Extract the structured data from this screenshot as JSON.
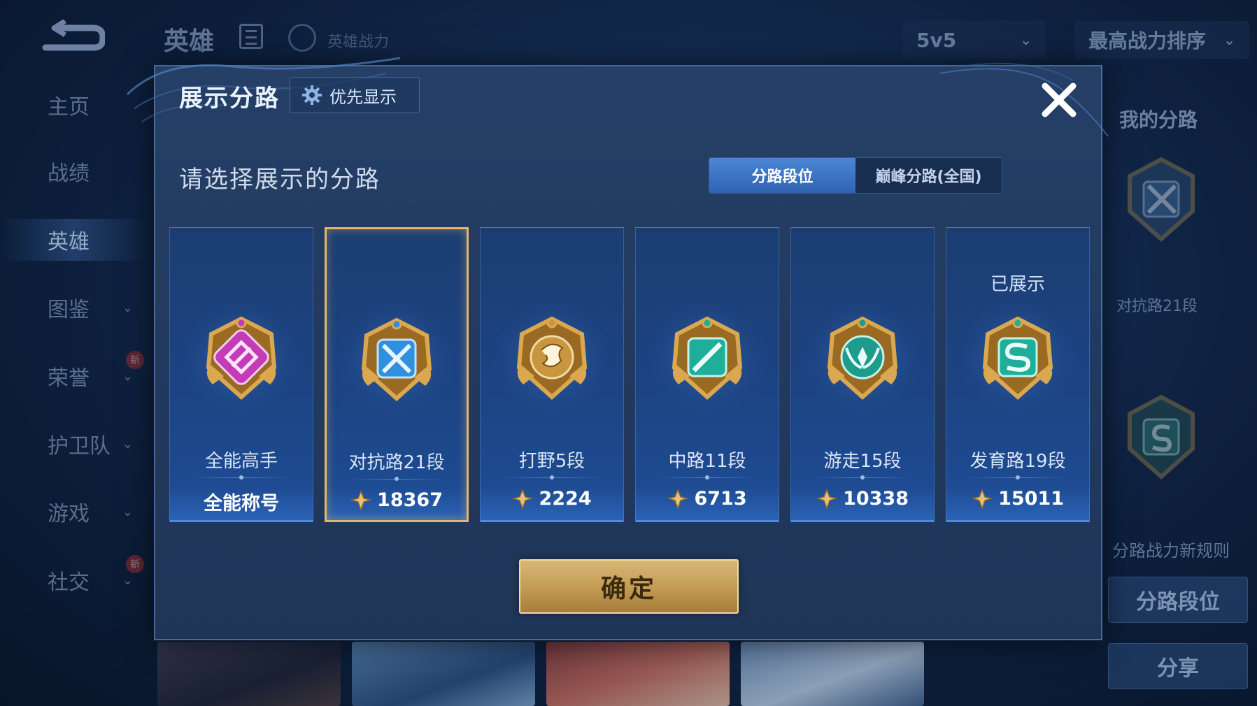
{
  "background": {
    "top_title": "英雄",
    "top_power_label": "英雄战力",
    "mode_select": "5v5",
    "sort_select": "最高战力排序",
    "sidebar": [
      {
        "label": "主页",
        "chevron": false,
        "new": false,
        "active": false
      },
      {
        "label": "战绩",
        "chevron": false,
        "new": false,
        "active": false
      },
      {
        "label": "英雄",
        "chevron": false,
        "new": false,
        "active": true
      },
      {
        "label": "图鉴",
        "chevron": true,
        "new": false,
        "active": false
      },
      {
        "label": "荣誉",
        "chevron": true,
        "new": true,
        "active": false
      },
      {
        "label": "护卫队",
        "chevron": true,
        "new": false,
        "active": false
      },
      {
        "label": "游戏",
        "chevron": true,
        "new": false,
        "active": false
      },
      {
        "label": "社交",
        "chevron": true,
        "new": true,
        "active": false
      }
    ],
    "new_badge": "新",
    "right_panel": {
      "title": "我的分路",
      "lane_label": "对抗路21段",
      "rule_text": "分路战力新规则",
      "lane_button": "分路段位",
      "share_button": "分享"
    }
  },
  "modal": {
    "title": "展示分路",
    "pref_button": "优先显示",
    "subtitle": "请选择展示的分路",
    "tabs": [
      {
        "label": "分路段位",
        "active": true
      },
      {
        "label": "巅峰分路(全国)",
        "active": false
      }
    ],
    "lanes": [
      {
        "name": "全能高手",
        "footer": "全能称号",
        "has_power": false,
        "selected": false,
        "shown": false,
        "emblem": "all-round-emblem-icon",
        "color": "#c43bb8"
      },
      {
        "name": "对抗路21段",
        "footer": "18367",
        "has_power": true,
        "selected": true,
        "shown": false,
        "emblem": "clash-lane-emblem-icon",
        "color": "#2f8fe0"
      },
      {
        "name": "打野5段",
        "footer": "2224",
        "has_power": true,
        "selected": false,
        "shown": false,
        "emblem": "jungle-emblem-icon",
        "color": "#c9963f"
      },
      {
        "name": "中路11段",
        "footer": "6713",
        "has_power": true,
        "selected": false,
        "shown": false,
        "emblem": "mid-lane-emblem-icon",
        "color": "#1fae9a"
      },
      {
        "name": "游走15段",
        "footer": "10338",
        "has_power": true,
        "selected": false,
        "shown": false,
        "emblem": "roam-emblem-icon",
        "color": "#1d9c8c"
      },
      {
        "name": "发育路19段",
        "footer": "15011",
        "has_power": true,
        "selected": false,
        "shown": true,
        "emblem": "farm-lane-emblem-icon",
        "color": "#1fae9a"
      }
    ],
    "shown_tag": "已展示",
    "confirm_button": "确定"
  },
  "colors": {
    "accent_gold": "#e3b66d",
    "tab_active": "#3a74c4",
    "modal_bg": "#22395e"
  }
}
